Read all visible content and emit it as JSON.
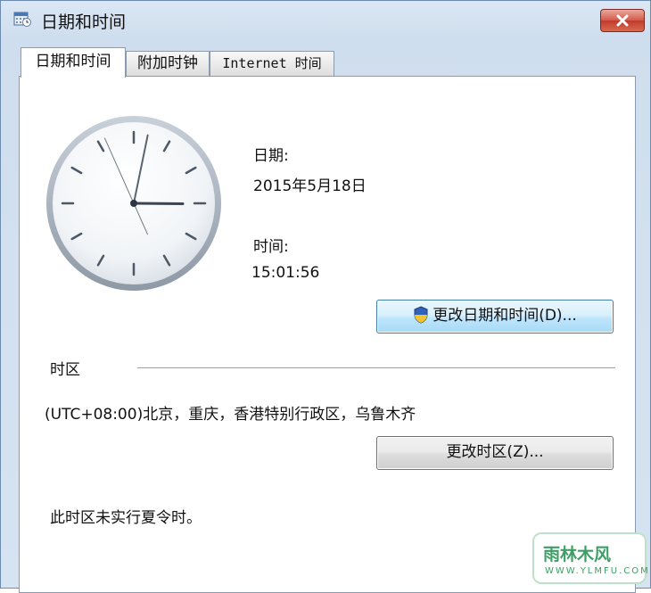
{
  "window": {
    "title": "日期和时间",
    "close_icon": "close-icon"
  },
  "tabs": [
    {
      "label": "日期和时间",
      "active": true
    },
    {
      "label": "附加时钟",
      "active": false
    },
    {
      "label": "Internet 时间",
      "active": false
    }
  ],
  "date_time": {
    "date_label": "日期:",
    "date_value": "2015年5月18日",
    "time_label": "时间:",
    "time_value": "15:01:56",
    "change_button": "更改日期和时间(D)...",
    "change_button_icon": "uac-shield-icon"
  },
  "timezone": {
    "section_label": "时区",
    "value": "(UTC+08:00)北京，重庆，香港特别行政区，乌鲁木齐",
    "change_button": "更改时区(Z)...",
    "dst_note": "此时区未实行夏令时。"
  },
  "watermark": {
    "text": "雨林木风",
    "url": "WWW.YLMFU.COM"
  },
  "clock": {
    "hours": 15,
    "minutes": 1,
    "seconds": 56
  },
  "colors": {
    "title_bg": "#d6e3f1",
    "close_red": "#c23a2c",
    "button_blue": "#bee6fd"
  }
}
